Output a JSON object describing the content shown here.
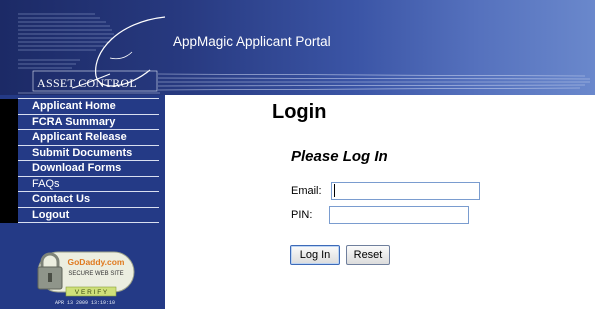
{
  "header": {
    "portal_title": "AppMagic Applicant Portal",
    "logo_text": "ASSET CONTROL",
    "logo_letter": "A"
  },
  "nav": {
    "items": [
      {
        "label": "Applicant Home",
        "bold": true
      },
      {
        "label": "FCRA Summary",
        "bold": true
      },
      {
        "label": "Applicant Release",
        "bold": true
      },
      {
        "label": "Submit Documents",
        "bold": true
      },
      {
        "label": "Download Forms",
        "bold": true
      },
      {
        "label": "FAQs",
        "bold": false
      },
      {
        "label": "Contact Us",
        "bold": true
      },
      {
        "label": "Logout",
        "bold": true
      }
    ]
  },
  "seal": {
    "brand": "GoDaddy.com",
    "line": "SECURE WEB SITE",
    "verify": "V E R I F Y",
    "date": "APR 13 2009 13:19:10"
  },
  "main": {
    "title": "Login",
    "subtitle": "Please Log In",
    "email_label": "Email:",
    "email_value": "",
    "pin_label": "PIN:",
    "pin_value": "",
    "login_button": "Log In",
    "reset_button": "Reset"
  },
  "colors": {
    "sidebar": "#243a86",
    "header_dark": "#1c2a66",
    "header_light": "#6a88cc",
    "field_border": "#7a9ccf"
  }
}
